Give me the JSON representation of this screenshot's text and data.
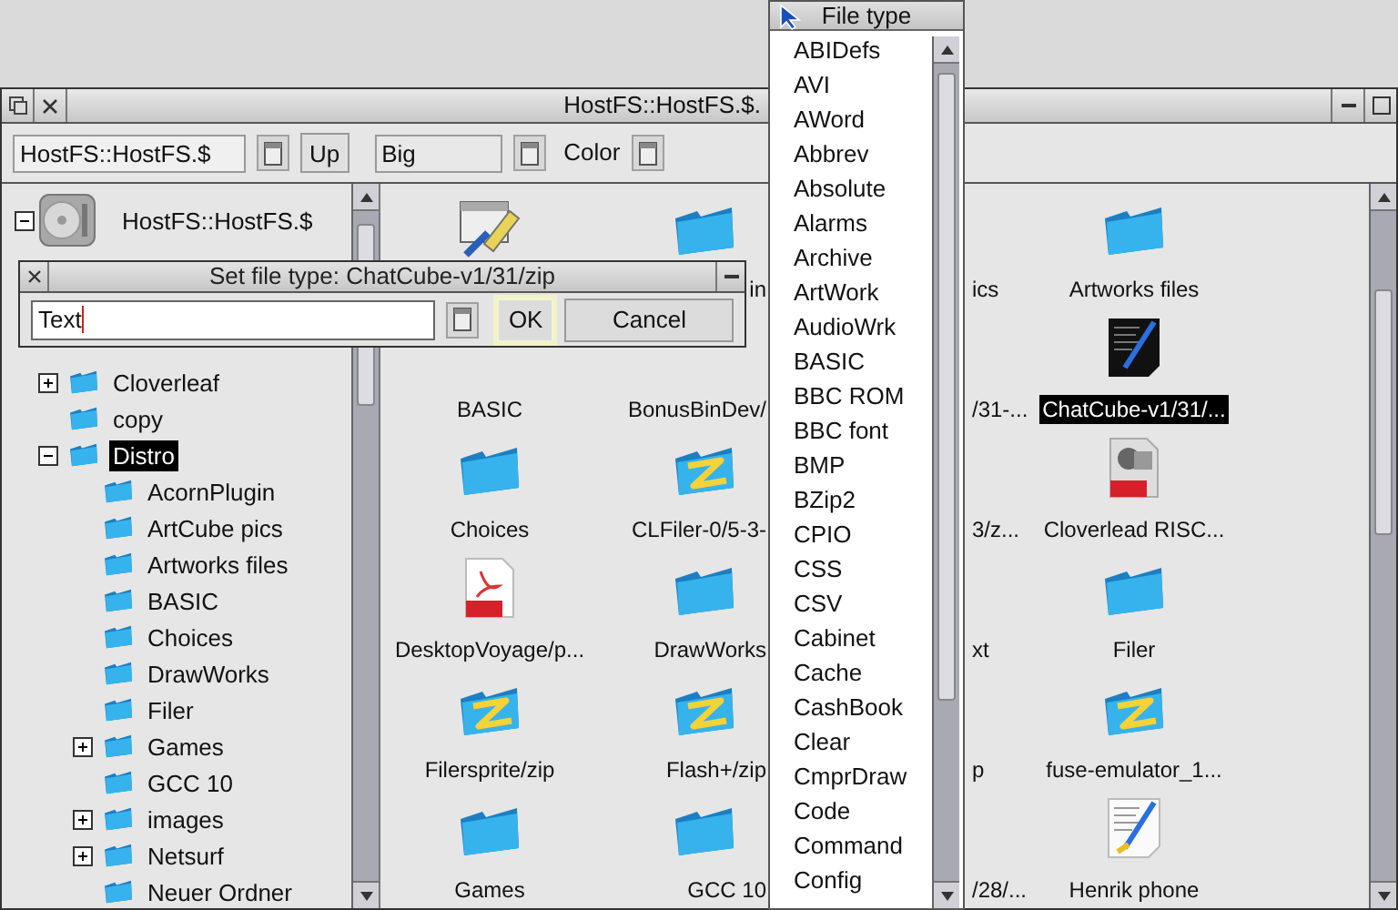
{
  "filer": {
    "title": "HostFS::HostFS.$.",
    "path_field": {
      "value": "HostFS::HostFS.$"
    },
    "up_button": "Up",
    "view_field": {
      "value": "Big"
    },
    "color_label": "Color",
    "tree": {
      "label": "HostFS::HostFS.$",
      "expanded": true,
      "selected": false,
      "children": [
        {
          "label": "Cloverleaf",
          "expanded": false,
          "selected": false
        },
        {
          "label": "copy",
          "selected": false
        },
        {
          "label": "Distro",
          "expanded": true,
          "selected": true,
          "children": [
            {
              "label": "AcornPlugin",
              "selected": false
            },
            {
              "label": "ArtCube pics",
              "selected": false
            },
            {
              "label": "Artworks files",
              "selected": false
            },
            {
              "label": "BASIC",
              "selected": false
            },
            {
              "label": "Choices",
              "selected": false
            },
            {
              "label": "DrawWorks",
              "selected": false
            },
            {
              "label": "Filer",
              "selected": false
            },
            {
              "label": "Games",
              "expanded": false,
              "selected": false
            },
            {
              "label": "GCC 10",
              "selected": false
            },
            {
              "label": "images",
              "expanded": false,
              "selected": false
            },
            {
              "label": "Netsurf",
              "expanded": false,
              "selected": false
            },
            {
              "label": "Neuer Ordner",
              "selected": false
            }
          ]
        }
      ]
    },
    "files": [
      {
        "kind": "app"
      },
      {
        "kind": "folder",
        "label": "in",
        "selected": false
      },
      {
        "label": "ics",
        "selected": false
      },
      {
        "kind": "folder",
        "label": "Artworks files",
        "selected": false
      },
      {
        "label": "BASIC",
        "selected": false
      },
      {
        "label": "BonusBinDev/",
        "selected": false
      },
      {
        "label": "/31-...",
        "selected": false
      },
      {
        "kind": "darkdoc",
        "label": "ChatCube-v1/31/...",
        "selected": true
      },
      {
        "kind": "folder",
        "label": "Choices",
        "selected": false
      },
      {
        "kind": "zip",
        "label": "CLFiler-0/5-3-",
        "selected": false
      },
      {
        "label": "3/z...",
        "selected": false
      },
      {
        "kind": "jpeg",
        "label": "Cloverlead RISC...",
        "selected": false
      },
      {
        "kind": "pdf",
        "label": "DesktopVoyage/p...",
        "selected": false
      },
      {
        "kind": "folder",
        "label": "DrawWorks",
        "selected": false
      },
      {
        "label": "xt",
        "selected": false
      },
      {
        "kind": "folder",
        "label": "Filer",
        "selected": false
      },
      {
        "kind": "zip",
        "label": "Filersprite/zip",
        "selected": false
      },
      {
        "kind": "zip",
        "label": "Flash+/zip",
        "selected": false
      },
      {
        "label": "p",
        "selected": false
      },
      {
        "kind": "zip",
        "label": "fuse-emulator_1...",
        "selected": false
      },
      {
        "kind": "folder",
        "label": "Games",
        "selected": false
      },
      {
        "kind": "folder",
        "label": "GCC 10",
        "selected": false
      },
      {
        "label": "/28/...",
        "selected": false
      },
      {
        "kind": "doc",
        "label": "Henrik phone",
        "selected": false
      }
    ]
  },
  "dialog": {
    "title": "Set file type: ChatCube-v1/31/zip",
    "input": {
      "value": "Text"
    },
    "buttons": [
      {
        "label": "OK",
        "default": true
      },
      {
        "label": "Cancel",
        "default": false
      }
    ]
  },
  "menu": {
    "title": "File type",
    "items": [
      "ABIDefs",
      "AVI",
      "AWord",
      "Abbrev",
      "Absolute",
      "Alarms",
      "Archive",
      "ArtWork",
      "AudioWrk",
      "BASIC",
      "BBC ROM",
      "BBC font",
      "BMP",
      "BZip2",
      "CPIO",
      "CSS",
      "CSV",
      "Cabinet",
      "Cache",
      "CashBook",
      "Clear",
      "CmprDraw",
      "Code",
      "Command",
      "Config"
    ]
  }
}
